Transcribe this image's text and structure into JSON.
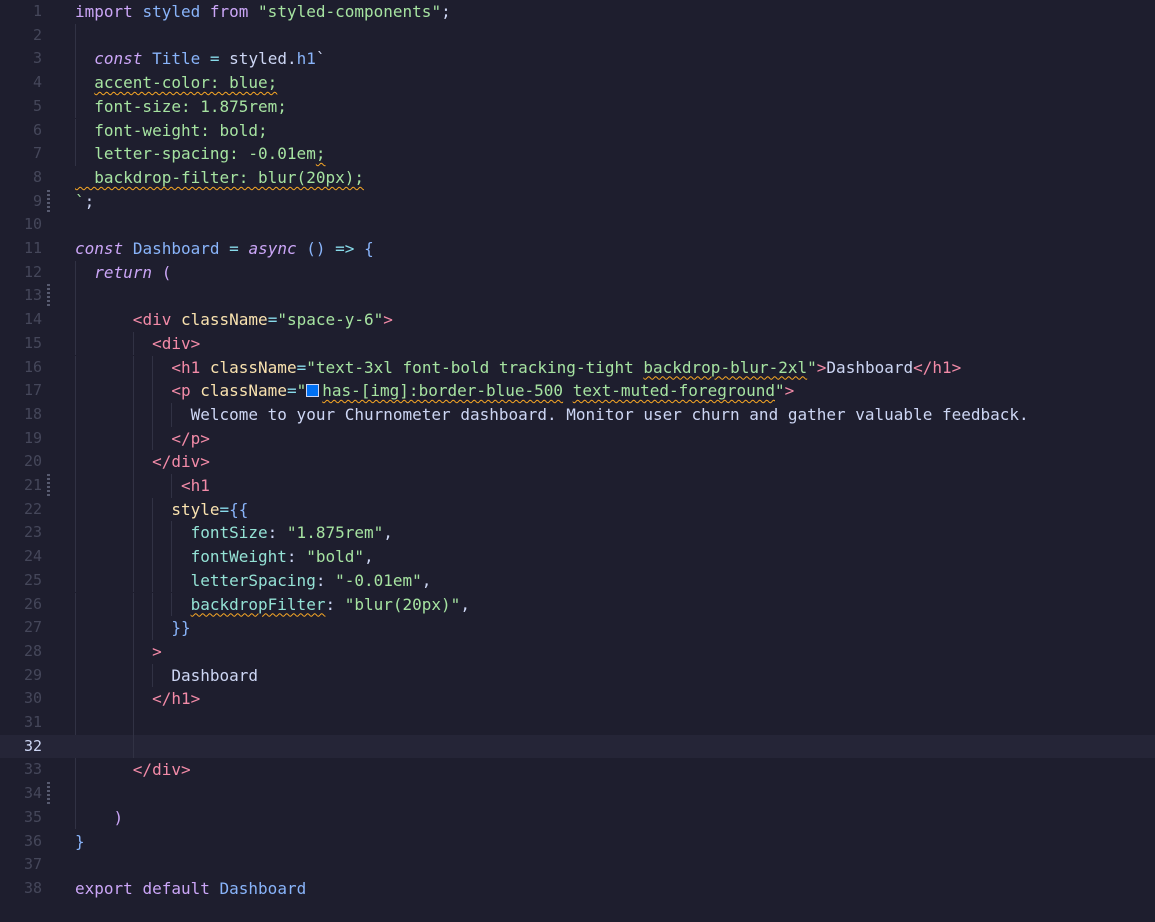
{
  "editor": {
    "current_line": 32,
    "lines": [
      {
        "num": "1",
        "text": "import styled from \"styled-components\";"
      },
      {
        "num": "2",
        "text": ""
      },
      {
        "num": "3",
        "text": "  const Title = styled.h1`"
      },
      {
        "num": "4",
        "text": "  accent-color: blue;"
      },
      {
        "num": "5",
        "text": "  font-size: 1.875rem;"
      },
      {
        "num": "6",
        "text": "  font-weight: bold;"
      },
      {
        "num": "7",
        "text": "  letter-spacing: -0.01em;"
      },
      {
        "num": "8",
        "text": "  backdrop-filter: blur(20px);"
      },
      {
        "num": "9",
        "text": "`;"
      },
      {
        "num": "10",
        "text": ""
      },
      {
        "num": "11",
        "text": "const Dashboard = async () => {"
      },
      {
        "num": "12",
        "text": "  return ("
      },
      {
        "num": "13",
        "text": ""
      },
      {
        "num": "14",
        "text": "      <div className=\"space-y-6\">"
      },
      {
        "num": "15",
        "text": "        <div>"
      },
      {
        "num": "16",
        "text": "          <h1 className=\"text-3xl font-bold tracking-tight backdrop-blur-2xl\">Dashboard</h1>"
      },
      {
        "num": "17",
        "text": "          <p className=\" has-[img]:border-blue-500 text-muted-foreground\">"
      },
      {
        "num": "18",
        "text": "            Welcome to your Churnometer dashboard. Monitor user churn and gather valuable feedback."
      },
      {
        "num": "19",
        "text": "          </p>"
      },
      {
        "num": "20",
        "text": "        </div>"
      },
      {
        "num": "21",
        "text": "           <h1"
      },
      {
        "num": "22",
        "text": "          style={{"
      },
      {
        "num": "23",
        "text": "            fontSize: \"1.875rem\","
      },
      {
        "num": "24",
        "text": "            fontWeight: \"bold\","
      },
      {
        "num": "25",
        "text": "            letterSpacing: \"-0.01em\","
      },
      {
        "num": "26",
        "text": "            backdropFilter: \"blur(20px)\","
      },
      {
        "num": "27",
        "text": "          }}"
      },
      {
        "num": "28",
        "text": "        >"
      },
      {
        "num": "29",
        "text": "          Dashboard"
      },
      {
        "num": "30",
        "text": "        </h1>"
      },
      {
        "num": "31",
        "text": ""
      },
      {
        "num": "32",
        "text": ""
      },
      {
        "num": "33",
        "text": "      </div>"
      },
      {
        "num": "34",
        "text": ""
      },
      {
        "num": "35",
        "text": "    )"
      },
      {
        "num": "36",
        "text": "}"
      },
      {
        "num": "37",
        "text": ""
      },
      {
        "num": "38",
        "text": "export default Dashboard"
      }
    ]
  },
  "colors": {
    "background": "#1e1e2e",
    "current_line": "#252537",
    "keyword": "#cba6f7",
    "string": "#a6e3a1",
    "tag": "#f38ba8",
    "identifier": "#89b4fa",
    "warning_squiggle": "#f9a825",
    "swatch_blue": "#0070f3"
  }
}
